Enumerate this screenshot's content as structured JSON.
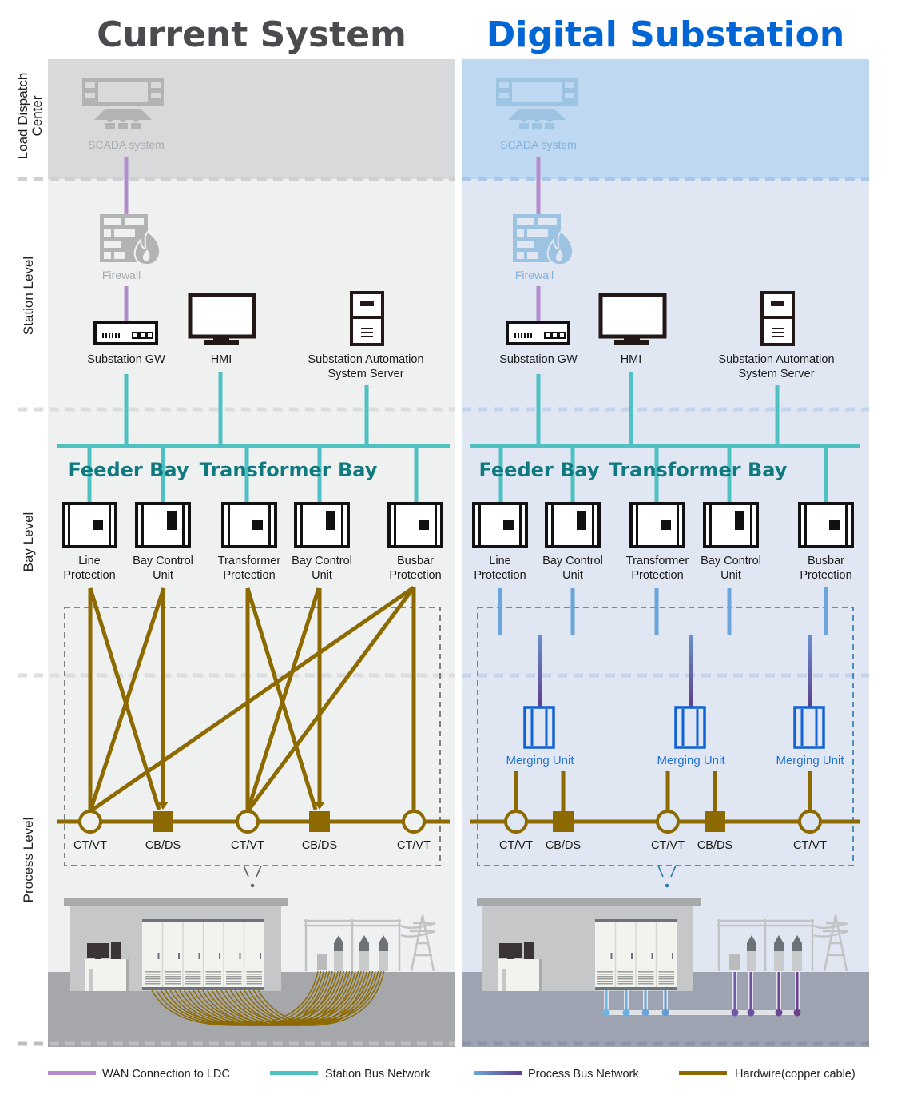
{
  "titles": {
    "left": "Current System",
    "right": "Digital Substation"
  },
  "levels": [
    {
      "id": "ldc",
      "line1": "Load Dispatch",
      "line2": "Center"
    },
    {
      "id": "station",
      "line1": "Station Level"
    },
    {
      "id": "bay",
      "line1": "Bay Level"
    },
    {
      "id": "process",
      "line1": "Process  Level"
    }
  ],
  "panels": {
    "left": {
      "scada_label": "SCADA system",
      "firewall_label": "Firewall",
      "gateway_label": "Substation GW",
      "hmi_label": "HMI",
      "server_label_1": "Substation Automation",
      "server_label_2": "System Server",
      "bay_headings": [
        "Feeder Bay",
        "Transformer Bay"
      ],
      "bay_devices": [
        {
          "line1": "Line",
          "line2": "Protection"
        },
        {
          "line1": "Bay Control",
          "line2": "Unit"
        },
        {
          "line1": "Transformer",
          "line2": "Protection"
        },
        {
          "line1": "Bay Control",
          "line2": "Unit"
        },
        {
          "line1": "Busbar",
          "line2": "Protection"
        }
      ],
      "process_devices": [
        "CT/VT",
        "CB/DS",
        "CT/VT",
        "CB/DS",
        "CT/VT"
      ]
    },
    "right": {
      "scada_label": "SCADA system",
      "firewall_label": "Firewall",
      "gateway_label": "Substation GW",
      "hmi_label": "HMI",
      "server_label_1": "Substation Automation",
      "server_label_2": "System Server",
      "bay_headings": [
        "Feeder Bay",
        "Transformer Bay"
      ],
      "bay_devices": [
        {
          "line1": "Line",
          "line2": "Protection"
        },
        {
          "line1": "Bay Control",
          "line2": "Unit"
        },
        {
          "line1": "Transformer",
          "line2": "Protection"
        },
        {
          "line1": "Bay Control",
          "line2": "Unit"
        },
        {
          "line1": "Busbar",
          "line2": "Protection"
        }
      ],
      "merging_units": [
        "Merging Unit",
        "Merging Unit",
        "Merging Unit"
      ],
      "process_devices": [
        "CT/VT",
        "CB/DS",
        "CT/VT",
        "CB/DS",
        "CT/VT"
      ]
    }
  },
  "legend": [
    {
      "label": "WAN Connection to LDC",
      "color": "#b48ccc"
    },
    {
      "label": "Station Bus Network",
      "color": "#4fc1c3"
    },
    {
      "label": "Process Bus Network",
      "color": "#5d5a9e"
    },
    {
      "label": "Hardwire(copper cable)",
      "color": "#8c6a00"
    }
  ],
  "colors": {
    "wan": "#b48ccc",
    "station_bus": "#4fc1c3",
    "process_bus_start": "#6aa6dc",
    "process_bus_end": "#5d3f8c",
    "hardwire": "#8c6a00",
    "left_bg": "#eff0f0",
    "left_ldc_bg": "#d8d9db",
    "right_bg": "#e1e6f3",
    "right_ldc_bg": "#bfd8f2",
    "accent_blue": "#0066d6",
    "bay_heading": "#0e7a80"
  }
}
